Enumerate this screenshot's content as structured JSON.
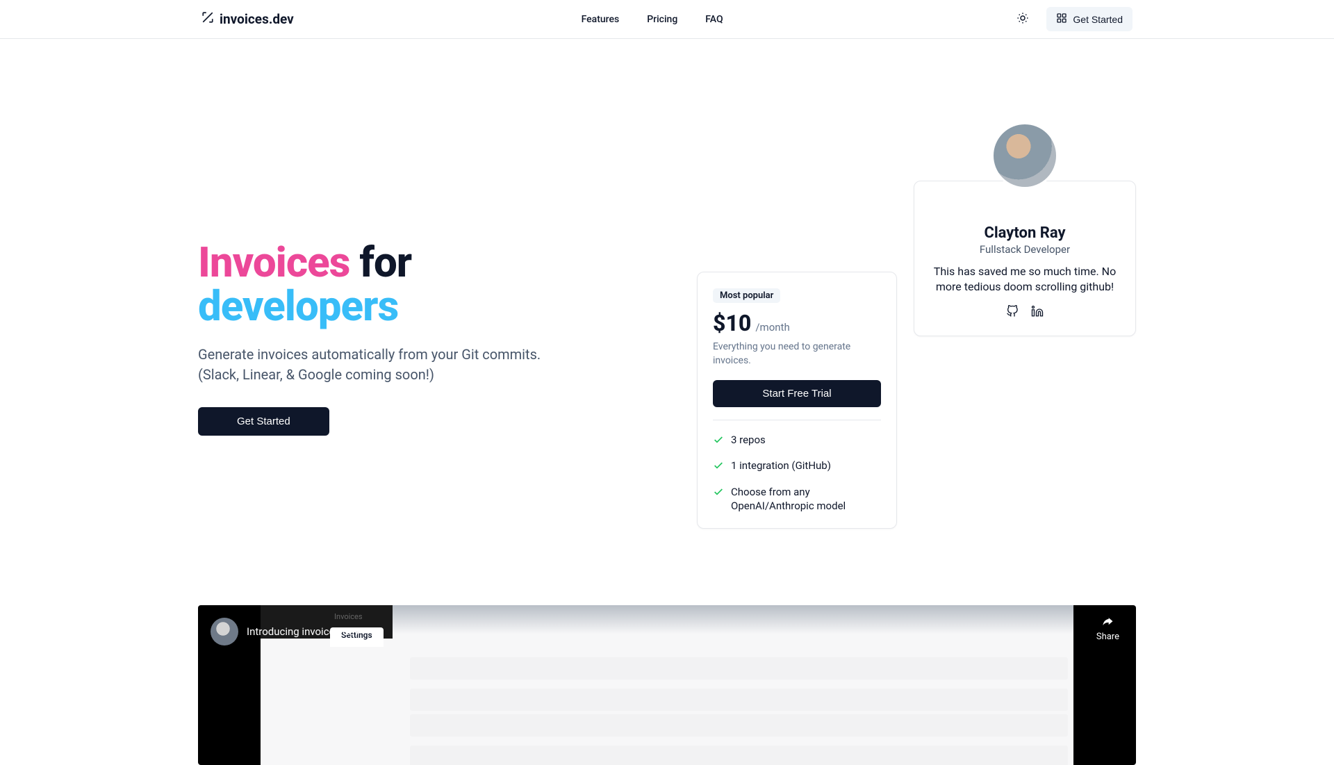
{
  "brand": "invoices.dev",
  "nav": {
    "features": "Features",
    "pricing": "Pricing",
    "faq": "FAQ"
  },
  "header_cta": "Get Started",
  "hero": {
    "word1": "Invoices",
    "word2": "for",
    "word3": "developers",
    "subtitle_line1": "Generate invoices automatically from your Git commits.",
    "subtitle_line2": "(Slack, Linear, & Google coming soon!)",
    "cta": "Get Started"
  },
  "pricing": {
    "badge": "Most popular",
    "price": "$10",
    "period": "/month",
    "description": "Everything you need to generate invoices.",
    "cta": "Start Free Trial",
    "features": [
      "3 repos",
      "1 integration (GitHub)",
      "Choose from any OpenAI/Anthropic model"
    ]
  },
  "testimonial": {
    "name": "Clayton Ray",
    "role": "Fullstack Developer",
    "quote": "This has saved me so much time. No more tedious doom scrolling github!"
  },
  "video": {
    "title": "Introducing invoices.dev",
    "tab_inactive": "Invoices",
    "tab_active": "Settings",
    "share": "Share"
  }
}
